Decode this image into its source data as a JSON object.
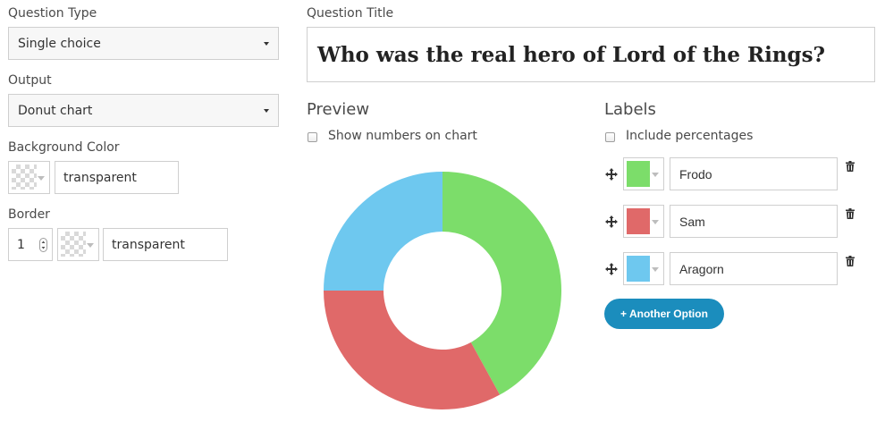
{
  "left_panel": {
    "question_type": {
      "label": "Question Type",
      "value": "Single choice"
    },
    "output": {
      "label": "Output",
      "value": "Donut chart"
    },
    "background_color": {
      "label": "Background Color",
      "value": "transparent"
    },
    "border": {
      "label": "Border",
      "width": "1",
      "value": "transparent"
    }
  },
  "question_title": {
    "label": "Question Title",
    "value": "Who was the real hero of Lord of the Rings?"
  },
  "preview": {
    "label": "Preview",
    "show_numbers_label": "Show numbers on chart"
  },
  "labels": {
    "label": "Labels",
    "include_percentages_label": "Include percentages",
    "options": [
      {
        "name": "Frodo",
        "color": "#7cdd6a"
      },
      {
        "name": "Sam",
        "color": "#e06969"
      },
      {
        "name": "Aragorn",
        "color": "#6ec8ef"
      }
    ],
    "add_button": "+ Another Option"
  },
  "chart_data": {
    "type": "pie",
    "donut": true,
    "categories": [
      "Frodo",
      "Sam",
      "Aragorn"
    ],
    "values": [
      42,
      33,
      25
    ],
    "colors": [
      "#7cdd6a",
      "#e06969",
      "#6ec8ef"
    ]
  }
}
